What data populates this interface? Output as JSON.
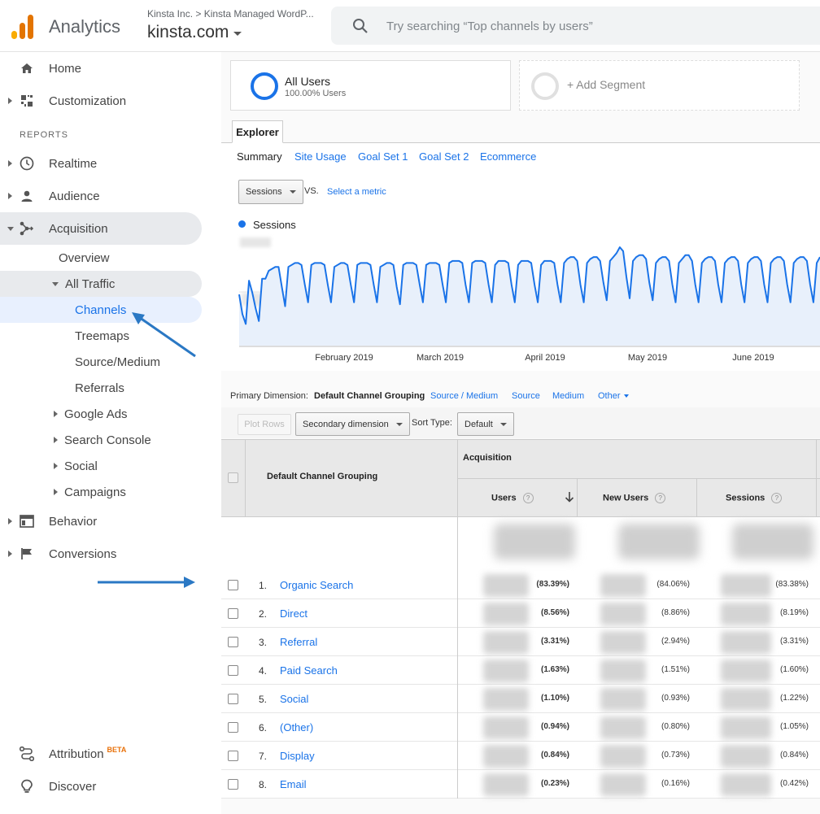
{
  "app": {
    "name": "Analytics",
    "account_path": "Kinsta Inc.  >  Kinsta Managed WordP...",
    "property": "kinsta.com",
    "search_placeholder": "Try searching “Top channels by users”",
    "logo_colors": [
      "#f9ab00",
      "#e37400",
      "#e37400"
    ]
  },
  "sidebar": {
    "home": "Home",
    "customization": "Customization",
    "reports_header": "REPORTS",
    "realtime": "Realtime",
    "audience": "Audience",
    "acquisition": "Acquisition",
    "overview": "Overview",
    "all_traffic": "All Traffic",
    "channels": "Channels",
    "treemaps": "Treemaps",
    "source_medium": "Source/Medium",
    "referrals": "Referrals",
    "google_ads": "Google Ads",
    "search_console": "Search Console",
    "social": "Social",
    "campaigns": "Campaigns",
    "behavior": "Behavior",
    "conversions": "Conversions",
    "attribution": "Attribution",
    "attribution_badge": "BETA",
    "discover": "Discover"
  },
  "segments": {
    "all_users": "All Users",
    "all_users_sub": "100.00% Users",
    "add_segment": "+ Add Segment"
  },
  "explorer": {
    "tab": "Explorer",
    "subtabs": [
      "Summary",
      "Site Usage",
      "Goal Set 1",
      "Goal Set 2",
      "Ecommerce"
    ]
  },
  "chart_controls": {
    "metric": "Sessions",
    "vs": "VS.",
    "select_metric": "Select a metric"
  },
  "chart_data": {
    "type": "area",
    "series": [
      {
        "name": "Sessions",
        "color": "#1a73e8"
      }
    ],
    "x_tick_labels": [
      "February 2019",
      "March 2019",
      "April 2019",
      "May 2019",
      "June 2019"
    ],
    "values": [
      0.52,
      0.32,
      0.22,
      0.66,
      0.54,
      0.38,
      0.25,
      0.68,
      0.68,
      0.76,
      0.78,
      0.8,
      0.8,
      0.6,
      0.4,
      0.8,
      0.82,
      0.84,
      0.84,
      0.82,
      0.62,
      0.44,
      0.82,
      0.84,
      0.84,
      0.84,
      0.82,
      0.62,
      0.44,
      0.8,
      0.82,
      0.84,
      0.84,
      0.82,
      0.62,
      0.44,
      0.82,
      0.84,
      0.84,
      0.84,
      0.82,
      0.62,
      0.44,
      0.8,
      0.82,
      0.84,
      0.84,
      0.82,
      0.6,
      0.42,
      0.82,
      0.84,
      0.84,
      0.84,
      0.82,
      0.62,
      0.44,
      0.82,
      0.84,
      0.84,
      0.84,
      0.82,
      0.62,
      0.44,
      0.84,
      0.86,
      0.86,
      0.86,
      0.84,
      0.62,
      0.44,
      0.84,
      0.86,
      0.86,
      0.86,
      0.84,
      0.62,
      0.44,
      0.82,
      0.86,
      0.86,
      0.86,
      0.84,
      0.62,
      0.44,
      0.82,
      0.86,
      0.86,
      0.86,
      0.84,
      0.62,
      0.44,
      0.82,
      0.86,
      0.86,
      0.86,
      0.84,
      0.62,
      0.44,
      0.84,
      0.88,
      0.9,
      0.9,
      0.86,
      0.62,
      0.44,
      0.84,
      0.88,
      0.9,
      0.9,
      0.86,
      0.64,
      0.46,
      0.86,
      0.9,
      0.94,
      1.0,
      0.96,
      0.7,
      0.48,
      0.86,
      0.9,
      0.92,
      0.92,
      0.88,
      0.64,
      0.46,
      0.84,
      0.88,
      0.9,
      0.9,
      0.86,
      0.62,
      0.44,
      0.84,
      0.88,
      0.92,
      0.92,
      0.86,
      0.62,
      0.44,
      0.84,
      0.88,
      0.9,
      0.9,
      0.86,
      0.62,
      0.44,
      0.84,
      0.88,
      0.9,
      0.9,
      0.86,
      0.62,
      0.44,
      0.84,
      0.88,
      0.9,
      0.9,
      0.86,
      0.62,
      0.44,
      0.84,
      0.88,
      0.9,
      0.9,
      0.86,
      0.62,
      0.44,
      0.84,
      0.88,
      0.9,
      0.9,
      0.86,
      0.62,
      0.44,
      0.84,
      0.9
    ],
    "y_scale_note": "values hidden (blurred) in original; relative levels only",
    "grid": true
  },
  "dimensions": {
    "primary_label": "Primary Dimension:",
    "current": "Default Channel Grouping",
    "options": [
      "Source / Medium",
      "Source",
      "Medium",
      "Other"
    ]
  },
  "toolbar": {
    "plot_rows": "Plot Rows",
    "secondary_dimension": "Secondary dimension",
    "sort_type_label": "Sort Type:",
    "sort_type_value": "Default"
  },
  "table": {
    "dim_header": "Default Channel Grouping",
    "group_header": "Acquisition",
    "columns": [
      "Users",
      "New Users",
      "Sessions"
    ],
    "rows": [
      {
        "num": "1.",
        "name": "Organic Search",
        "users_pct": "(83.39%)",
        "new_users_pct": "(84.06%)",
        "sessions_pct": "(83.38%)"
      },
      {
        "num": "2.",
        "name": "Direct",
        "users_pct": "(8.56%)",
        "new_users_pct": "(8.86%)",
        "sessions_pct": "(8.19%)"
      },
      {
        "num": "3.",
        "name": "Referral",
        "users_pct": "(3.31%)",
        "new_users_pct": "(2.94%)",
        "sessions_pct": "(3.31%)"
      },
      {
        "num": "4.",
        "name": "Paid Search",
        "users_pct": "(1.63%)",
        "new_users_pct": "(1.51%)",
        "sessions_pct": "(1.60%)"
      },
      {
        "num": "5.",
        "name": "Social",
        "users_pct": "(1.10%)",
        "new_users_pct": "(0.93%)",
        "sessions_pct": "(1.22%)"
      },
      {
        "num": "6.",
        "name": "(Other)",
        "users_pct": "(0.94%)",
        "new_users_pct": "(0.80%)",
        "sessions_pct": "(1.05%)"
      },
      {
        "num": "7.",
        "name": "Display",
        "users_pct": "(0.84%)",
        "new_users_pct": "(0.73%)",
        "sessions_pct": "(0.84%)"
      },
      {
        "num": "8.",
        "name": "Email",
        "users_pct": "(0.23%)",
        "new_users_pct": "(0.16%)",
        "sessions_pct": "(0.42%)"
      }
    ]
  }
}
